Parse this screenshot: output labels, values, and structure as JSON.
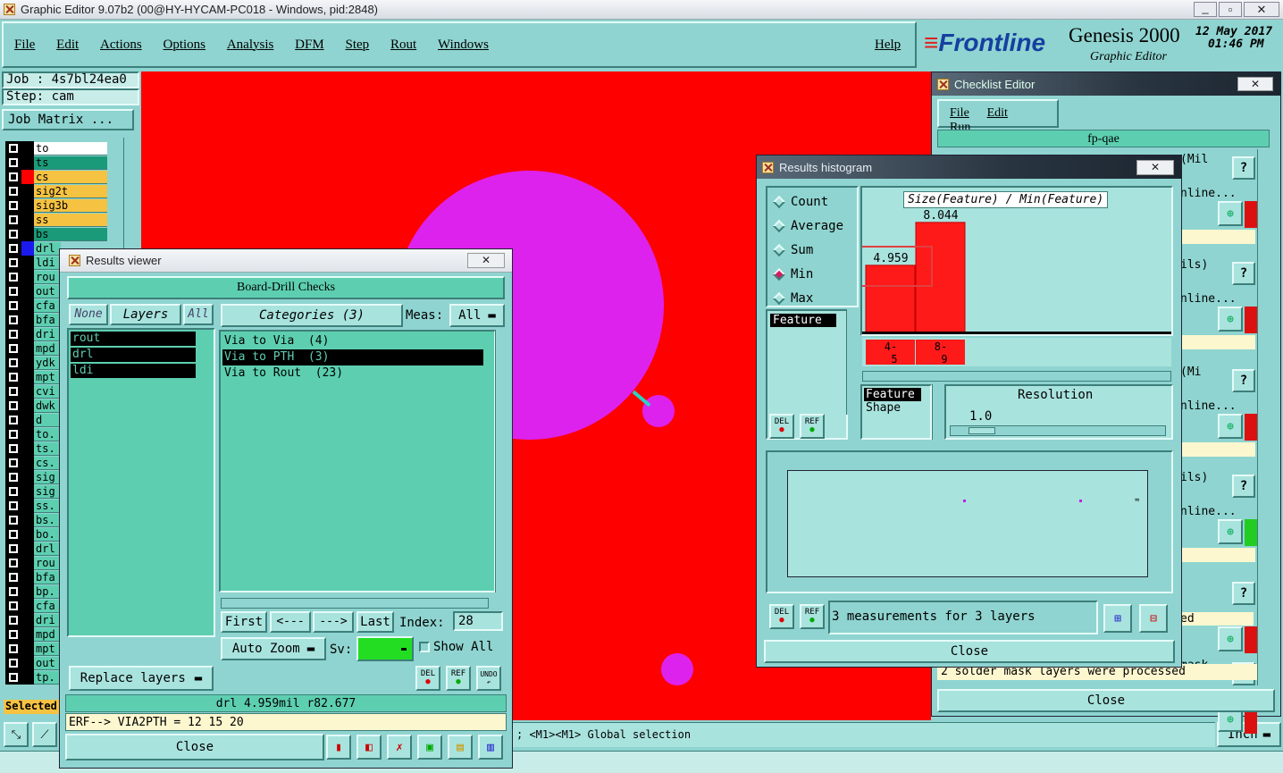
{
  "main_title": "Graphic Editor 9.07b2 (00@HY-HYCAM-PC018 - Windows, pid:2848)",
  "menu": [
    "File",
    "Edit",
    "Actions",
    "Options",
    "Analysis",
    "DFM",
    "Step",
    "Rout",
    "Windows"
  ],
  "help_label": "Help",
  "brand": {
    "logo": "Frontline",
    "product": "Genesis 2000",
    "subtitle": "Graphic Editor",
    "date": "12 May 2017",
    "time": "01:46 PM"
  },
  "job": {
    "job_line": "Job : 4s7bl24ea0",
    "step_line": "Step: cam",
    "matrix_button": "Job Matrix ..."
  },
  "layers": [
    {
      "name": "to",
      "color": "#ffffff"
    },
    {
      "name": "ts",
      "color": "#1a9a78"
    },
    {
      "name": "cs",
      "color": "#f5c242"
    },
    {
      "name": "sig2t",
      "color": "#f5c242"
    },
    {
      "name": "sig3b",
      "color": "#f5c242"
    },
    {
      "name": "ss",
      "color": "#f5c242"
    },
    {
      "name": "bs",
      "color": "#1a9a78"
    },
    {
      "name": "drl",
      "color": "#5dcfb0"
    },
    {
      "name": "ldi",
      "color": "#5dcfb0"
    },
    {
      "name": "rou",
      "color": "#5dcfb0"
    },
    {
      "name": "out",
      "color": "#5dcfb0"
    },
    {
      "name": "cfa",
      "color": "#5dcfb0"
    },
    {
      "name": "bfa",
      "color": "#5dcfb0"
    },
    {
      "name": "dri",
      "color": "#5dcfb0"
    },
    {
      "name": "mpd",
      "color": "#5dcfb0"
    },
    {
      "name": "ydk",
      "color": "#5dcfb0"
    },
    {
      "name": "mpt",
      "color": "#5dcfb0"
    },
    {
      "name": "cvi",
      "color": "#5dcfb0"
    },
    {
      "name": "dwk",
      "color": "#5dcfb0"
    },
    {
      "name": "d",
      "color": "#5dcfb0"
    },
    {
      "name": "to.",
      "color": "#5dcfb0"
    },
    {
      "name": "ts.",
      "color": "#5dcfb0"
    },
    {
      "name": "cs.",
      "color": "#5dcfb0"
    },
    {
      "name": "sig",
      "color": "#5dcfb0"
    },
    {
      "name": "sig",
      "color": "#5dcfb0"
    },
    {
      "name": "ss.",
      "color": "#5dcfb0"
    },
    {
      "name": "bs.",
      "color": "#5dcfb0"
    },
    {
      "name": "bo.",
      "color": "#5dcfb0"
    },
    {
      "name": "drl",
      "color": "#5dcfb0"
    },
    {
      "name": "rou",
      "color": "#5dcfb0"
    },
    {
      "name": "bfa",
      "color": "#5dcfb0"
    },
    {
      "name": "bp.",
      "color": "#5dcfb0"
    },
    {
      "name": "cfa",
      "color": "#5dcfb0"
    },
    {
      "name": "dri",
      "color": "#5dcfb0"
    },
    {
      "name": "mpd",
      "color": "#5dcfb0"
    },
    {
      "name": "mpt",
      "color": "#5dcfb0"
    },
    {
      "name": "out",
      "color": "#5dcfb0"
    },
    {
      "name": "tp.",
      "color": "#5dcfb0"
    }
  ],
  "selected_label": "Selected",
  "results_viewer": {
    "title": "Results viewer",
    "header": "Board-Drill Checks",
    "none_btn": "None",
    "layers_btn": "Layers",
    "all_btn": "All",
    "layer_list": [
      "rout",
      "drl",
      "ldi"
    ],
    "categories_label": "Categories (3)",
    "meas_label": "Meas:",
    "meas_value": "All",
    "categories": [
      "Via to Via  (4)",
      "Via to PTH  (3)",
      "Via to Rout  (23)"
    ],
    "selected_category_index": 1,
    "first_btn": "First",
    "prev_btn": "<---",
    "next_btn": "--->",
    "last_btn": "Last",
    "index_label": "Index:",
    "index_value": "28",
    "auto_zoom": "Auto Zoom",
    "sv_label": "Sv:",
    "show_all": "Show All",
    "replace_layers": "Replace layers",
    "del_label": "DEL",
    "ref_label": "REF",
    "undo_label": "UNDO",
    "status1": "drl 4.959mil  r82.677",
    "status2": "ERF--> VIA2PTH = 12 15 20",
    "close": "Close"
  },
  "histogram": {
    "title": "Results histogram",
    "options": [
      "Count",
      "Average",
      "Sum",
      "Min",
      "Max"
    ],
    "selected_option": "Min",
    "feature_label": "Feature",
    "chart_title": "Size(Feature) / Min(Feature)",
    "feature_shape_1": "Feature",
    "feature_shape_2": "Shape",
    "resolution_label": "Resolution",
    "resolution_value": "1.0",
    "measurements": "3 measurements for 3 layers",
    "del_label": "DEL",
    "ref_label": "REF",
    "close": "Close"
  },
  "chart_data": {
    "type": "bar",
    "title": "Size(Feature) / Min(Feature)",
    "categories": [
      "4-5",
      "8-9"
    ],
    "values": [
      4.959,
      8.044
    ],
    "data_labels": [
      "4.959",
      "8.044"
    ],
    "ylim": [
      0,
      9
    ]
  },
  "checklist": {
    "title": "Checklist Editor",
    "menu": [
      "File",
      "Edit",
      "Run"
    ],
    "name": "fp-qae",
    "row_texts": [
      "(Mil",
      "nline...",
      "ils)",
      "nline...",
      "(Mi",
      "nline...",
      "ils)",
      "nline...",
      "ed",
      "mask",
      "nline..."
    ],
    "message": "2 solder mask layers were processed",
    "close": "Close"
  },
  "status_bar": {
    "hint": "; <M1><M1> Global selection",
    "units": "Inch"
  },
  "colors": {
    "canvas": "#ff0000",
    "pad": "#dd22ee",
    "accent": "#5dcfb0"
  }
}
